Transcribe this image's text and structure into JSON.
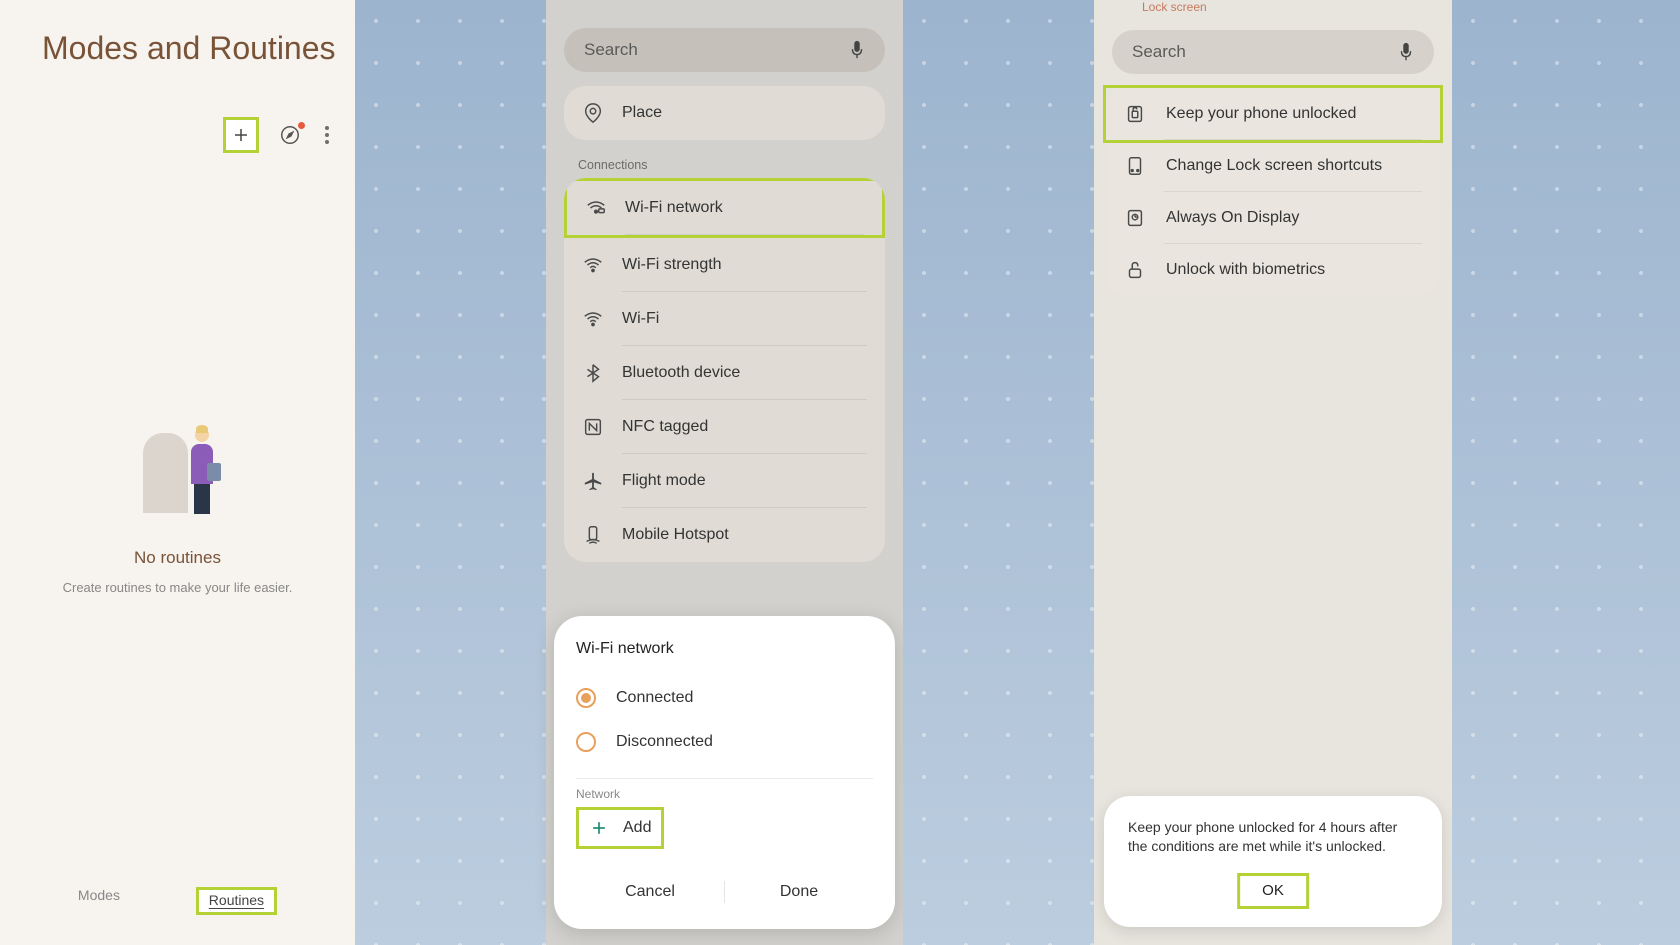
{
  "panel1": {
    "title": "Modes and Routines",
    "no_routines": "No routines",
    "subtitle": "Create routines to make your life easier.",
    "tabs": {
      "modes": "Modes",
      "routines": "Routines"
    }
  },
  "panel2": {
    "search_placeholder": "Search",
    "place_label": "Place",
    "connections_header": "Connections",
    "items": {
      "wifi_network": "Wi-Fi network",
      "wifi_strength": "Wi-Fi strength",
      "wifi": "Wi-Fi",
      "bluetooth": "Bluetooth device",
      "nfc": "NFC tagged",
      "flight": "Flight mode",
      "hotspot": "Mobile Hotspot"
    },
    "dialog": {
      "title": "Wi-Fi network",
      "connected": "Connected",
      "disconnected": "Disconnected",
      "network_label": "Network",
      "add": "Add",
      "cancel": "Cancel",
      "done": "Done"
    }
  },
  "panel3": {
    "top_label": "Lock screen",
    "search_placeholder": "Search",
    "items": {
      "keep_unlocked": "Keep your phone unlocked",
      "change_shortcuts": "Change Lock screen shortcuts",
      "aod": "Always On Display",
      "biometrics": "Unlock with biometrics"
    },
    "toast": {
      "text": "Keep your phone unlocked for 4 hours after the conditions are met while it's unlocked.",
      "ok": "OK"
    }
  }
}
